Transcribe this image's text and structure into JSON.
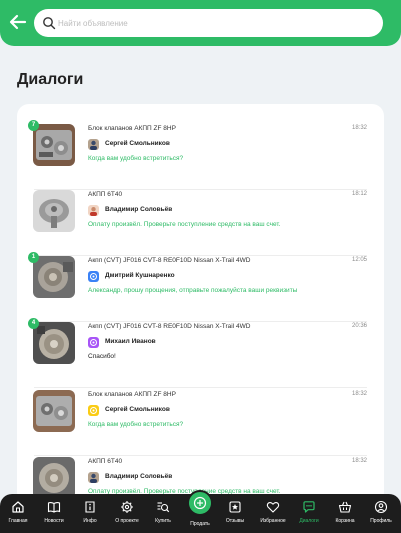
{
  "search": {
    "placeholder": "Найти объявление"
  },
  "page_title": "Диалоги",
  "dialogs": [
    {
      "badge": "7",
      "title": "Блок клапанов АКПП ZF 8HP",
      "time": "18:32",
      "user": "Сергей Смольников",
      "message": "Когда вам удобно встретиться?",
      "avatar_icon": "user-photo-icon"
    },
    {
      "badge": "",
      "title": "АКПП 6T40",
      "time": "18:12",
      "user": "Владимир Соловьёв",
      "message": "Оплату произвёл. Проверьте поступление средств на ваш счет.",
      "avatar_icon": "user-photo-icon"
    },
    {
      "badge": "1",
      "title": "Акпп (CVT) JF016 CVT-8 RE0F10D Nissan X-Trail 4WD",
      "time": "12:05",
      "user": "Дмитрий Кушнаренко",
      "message": "Александр, прошу прощения, отправьте пожалуйста ваши реквизиты",
      "avatar_icon": "blue-avatar-icon"
    },
    {
      "badge": "4",
      "title": "Акпп (CVT) JF016 CVT-8 RE0F10D Nissan X-Trail 4WD",
      "time": "20:36",
      "user": "Михаил Иванов",
      "message": "Спасибо!",
      "avatar_icon": "purple-avatar-icon"
    },
    {
      "badge": "",
      "title": "Блок клапанов АКПП ZF 8HP",
      "time": "18:32",
      "user": "Сергей Смольников",
      "message": "Когда вам удобно встретиться?",
      "avatar_icon": "yellow-avatar-icon"
    },
    {
      "badge": "",
      "title": "АКПП 6T40",
      "time": "18:32",
      "user": "Владимир Соловьёв",
      "message": "Оплату произвёл. Проверьте поступление средств на ваш счет.",
      "avatar_icon": "user-photo-icon"
    }
  ],
  "nav": {
    "home": "Главная",
    "news": "Новости",
    "info": "Инфо",
    "about": "О проекте",
    "buy": "Купить",
    "post": "Продать",
    "reviews": "Отзывы",
    "favorites": "Избранное",
    "dialogs": "Диалоги",
    "cart": "Корзина",
    "profile": "Профиль"
  },
  "colors": {
    "accent": "#2ebb66",
    "nav_bg": "#1d1d1d"
  }
}
